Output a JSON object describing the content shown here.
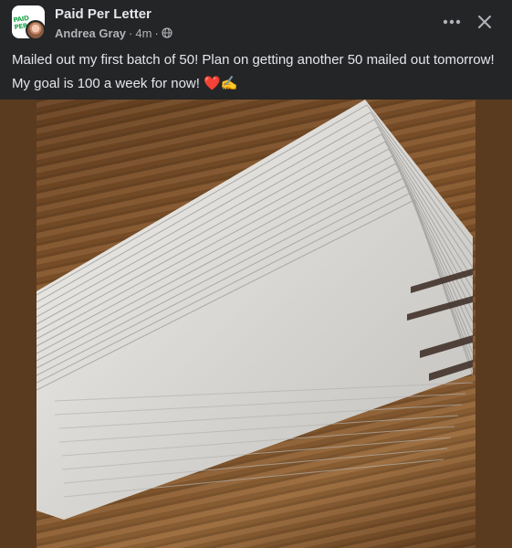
{
  "post": {
    "group_name": "Paid Per Letter",
    "group_logo_text": "PAID PER",
    "author": "Andrea Gray",
    "separator": "·",
    "time": "4m",
    "text_line1": "Mailed out my first batch of 50! Plan on getting another 50 mailed out tomorrow!",
    "text_line2": "My goal is 100 a week for now!",
    "emoji_heart": "❤️",
    "emoji_writing": "✍️"
  },
  "icons": {
    "more": "more-horizontal-icon",
    "close": "close-icon",
    "privacy": "globe-icon"
  },
  "colors": {
    "background": "#242526",
    "text_primary": "#e4e6eb",
    "text_secondary": "#b0b3b8",
    "media_backdrop": "#5a3b1f"
  }
}
